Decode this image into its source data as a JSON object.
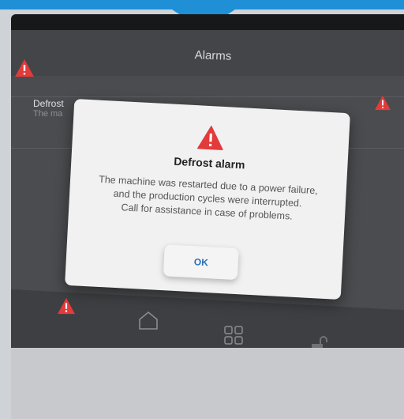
{
  "screen": {
    "title": "Alarms",
    "alarm_row": {
      "title": "Defrost",
      "subtitle": "The ma"
    }
  },
  "dialog": {
    "title": "Defrost alarm",
    "message_line1": "The machine was restarted due to a power failure,",
    "message_line2": "and the production cycles were interrupted.",
    "message_line3": "Call for assistance in case of problems.",
    "ok_label": "OK"
  },
  "nav": {
    "items": [
      "warning-icon",
      "home-icon",
      "grid-icon",
      "lock-icon"
    ]
  },
  "colors": {
    "accent": "#1f8fd6",
    "warning": "#e23b3b",
    "ok_text": "#2c6fb7"
  }
}
